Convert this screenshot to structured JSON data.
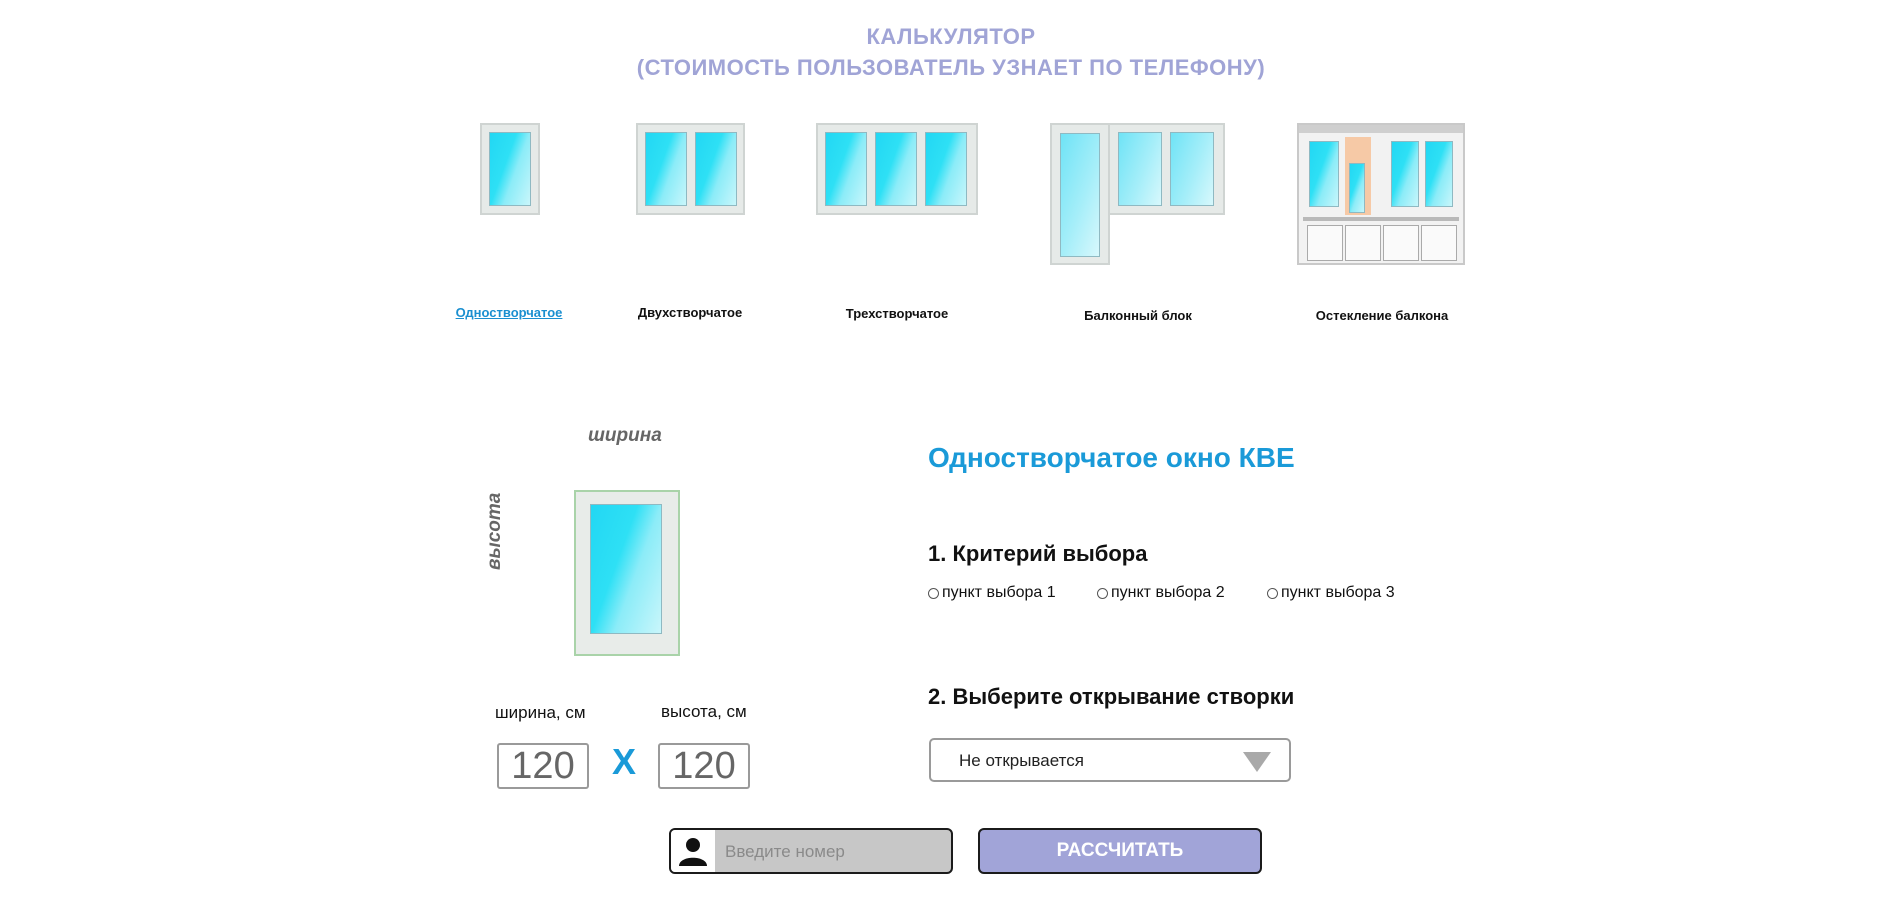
{
  "header": {
    "title": "КАЛЬКУЛЯТОР",
    "subtitle": "(СТОИМОСТЬ ПОЛЬЗОВАТЕЛЬ УЗНАЕТ ПО ТЕЛЕФОНУ)"
  },
  "window_types": [
    {
      "label": "Одностворчатое",
      "active": true
    },
    {
      "label": "Двухстворчатое",
      "active": false
    },
    {
      "label": "Трехстворчатое",
      "active": false
    },
    {
      "label": "Балконный блок",
      "active": false
    },
    {
      "label": "Остекление балкона",
      "active": false
    }
  ],
  "preview": {
    "width_axis_label": "ширина",
    "height_axis_label": "высота"
  },
  "dimensions": {
    "width_label": "ширина, см",
    "height_label": "высота, см",
    "width_value": "120",
    "height_value": "120",
    "times_sign": "X"
  },
  "config": {
    "window_title": "Одностворчатое окно КВЕ",
    "section1_title": "1. Критерий выбора",
    "options": [
      "пункт выбора 1",
      "пункт выбора 2",
      "пункт выбора 3"
    ],
    "section2_title": "2. Выберите открывание створки",
    "opening_selected": "Не открывается"
  },
  "footer": {
    "phone_placeholder": "Введите номер",
    "calc_label": "РАССЧИТАТЬ"
  },
  "colors": {
    "accent_blue": "#1a9ad8",
    "title_lavender": "#a0a4d6",
    "button_bg": "#a1a4d8"
  }
}
